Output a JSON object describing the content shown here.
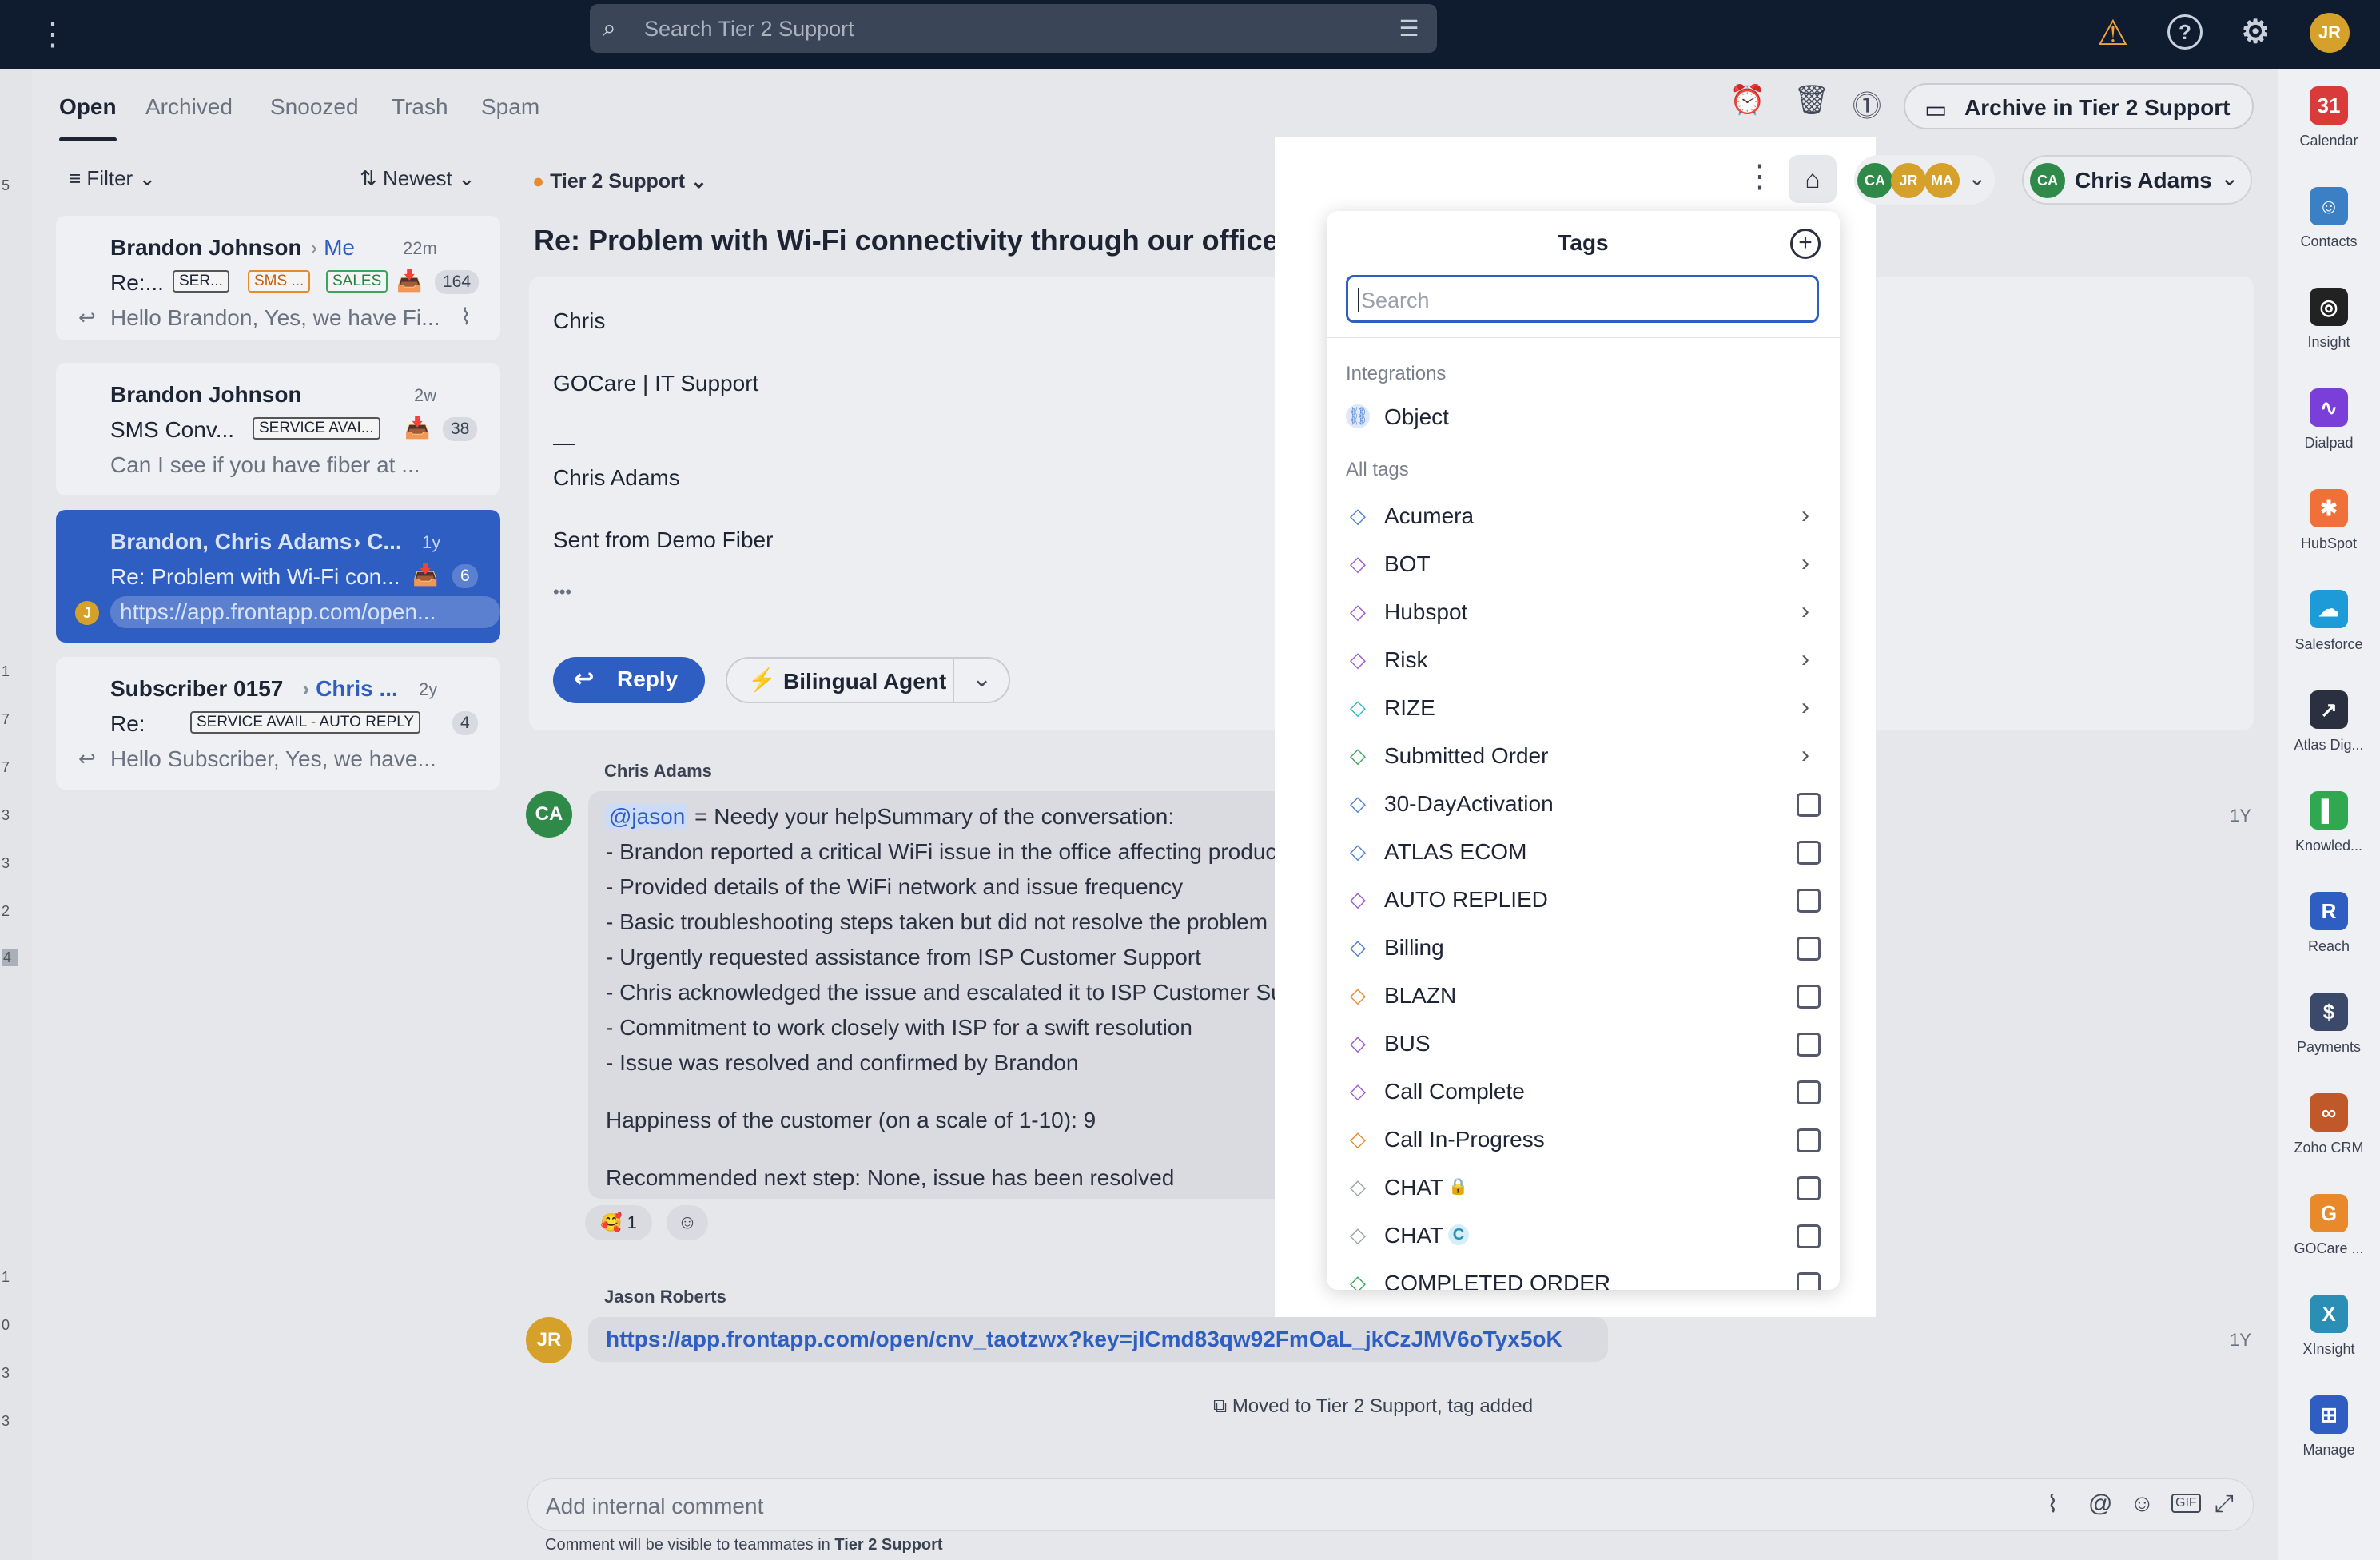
{
  "topbar": {
    "search_placeholder": "Search Tier 2 Support",
    "user_initials": "JR"
  },
  "tabs": [
    {
      "label": "Open",
      "active": true
    },
    {
      "label": "Archived"
    },
    {
      "label": "Snoozed"
    },
    {
      "label": "Trash"
    },
    {
      "label": "Spam"
    }
  ],
  "toolbar": {
    "archive_label": "Archive in Tier 2 Support"
  },
  "list": {
    "filter_label": "Filter",
    "sort_label": "Newest",
    "conversations": [
      {
        "name": "Brandon Johnson",
        "assignee": "Me",
        "time": "22m",
        "subject": "Re:...",
        "tags": [
          "SER...",
          "SMS ...",
          "SALES"
        ],
        "count": "164",
        "preview": "Hello Brandon, Yes, we have Fi..."
      },
      {
        "name": "Brandon Johnson",
        "time": "2w",
        "subject": "SMS Conv...",
        "tags": [
          "SERVICE AVAI..."
        ],
        "count": "38",
        "preview": "Can I see if you have fiber at ..."
      },
      {
        "name": "Brandon, Chris Adams",
        "assignee": "C...",
        "time": "1y",
        "subject": "Re: Problem with Wi-Fi con...",
        "count": "6",
        "preview": "https://app.frontapp.com/open...",
        "avatar": "J"
      },
      {
        "name": "Subscriber 0157",
        "assignee": "Chris ...",
        "time": "2y",
        "subject": "Re:",
        "tags": [
          "SERVICE AVAIL - AUTO REPLY"
        ],
        "count": "4",
        "preview": "Hello Subscriber, Yes, we have..."
      }
    ]
  },
  "left_strip_numbers": [
    "5",
    "1",
    "7",
    "7",
    "3",
    "3",
    "2",
    "4",
    "1",
    "0",
    "3",
    "3"
  ],
  "thread": {
    "inbox": "Tier 2 Support",
    "subject": "Re: Problem with Wi-Fi connectivity through our office",
    "message_lines": [
      "Chris",
      "GOCare | IT Support",
      "—",
      "Chris Adams",
      "Sent from Demo Fiber",
      "•••"
    ],
    "reply_label": "Reply",
    "agent_label": "Bilingual Agent",
    "comment": {
      "author": "Chris Adams",
      "avatar": "CA",
      "time": "1Y",
      "mention": "@jason",
      "first_line": " = Needy your helpSummary of the conversation:",
      "lines": [
        "- Brandon reported a critical WiFi issue in the office affecting productivity",
        "- Provided details of the WiFi network and issue frequency",
        "- Basic troubleshooting steps taken but did not resolve the problem",
        "- Urgently requested assistance from ISP Customer Support",
        "- Chris acknowledged the issue and escalated it to ISP Customer Support",
        "- Commitment to work closely with ISP for a swift resolution",
        "- Issue was resolved and confirmed by Brandon"
      ],
      "happiness": "Happiness of the customer (on a scale of 1-10): 9",
      "next_step": "Recommended next step: None, issue has been resolved",
      "reaction_count": "1"
    },
    "link_message": {
      "author": "Jason Roberts",
      "avatar": "JR",
      "time": "1Y",
      "url": "https://app.frontapp.com/open/cnv_taotzwx?key=jlCmd83qw92FmOaL_jkCzJMV6oTyx5oK"
    },
    "status_event": "Moved to Tier 2 Support, tag added",
    "composer_placeholder": "Add internal comment",
    "composer_hint_prefix": "Comment will be visible to teammates in ",
    "composer_hint_inbox": "Tier 2 Support"
  },
  "header_people": {
    "faces": [
      "CA",
      "JR",
      "MA"
    ],
    "assignee_initials": "CA",
    "assignee_name": "Chris Adams"
  },
  "tags_dropdown": {
    "title": "Tags",
    "search_placeholder": "Search",
    "integrations_label": "Integrations",
    "integration_item": "Object",
    "all_tags_label": "All tags",
    "tags": [
      {
        "name": "Acumera",
        "color": "#4a7fd4",
        "submenu": true
      },
      {
        "name": "BOT",
        "color": "#9b59d0",
        "submenu": true
      },
      {
        "name": "Hubspot",
        "color": "#9b59d0",
        "submenu": true
      },
      {
        "name": "Risk",
        "color": "#9b59d0",
        "submenu": true
      },
      {
        "name": "RIZE",
        "color": "#2bb5c7",
        "submenu": true
      },
      {
        "name": "Submitted Order",
        "color": "#3aa55b",
        "submenu": true
      },
      {
        "name": "30-DayActivation",
        "color": "#4a7fd4"
      },
      {
        "name": "ATLAS ECOM",
        "color": "#4a7fd4"
      },
      {
        "name": "AUTO REPLIED",
        "color": "#9b59d0"
      },
      {
        "name": "Billing",
        "color": "#4a7fd4"
      },
      {
        "name": "BLAZN",
        "color": "#e8892b"
      },
      {
        "name": "BUS",
        "color": "#9b59d0"
      },
      {
        "name": "Call Complete",
        "color": "#9b59d0"
      },
      {
        "name": "Call In-Progress",
        "color": "#e8892b"
      },
      {
        "name": "CHAT",
        "color": "#9aa1ad",
        "badge": "🔒"
      },
      {
        "name": "CHAT",
        "color": "#9aa1ad",
        "badge": "C"
      },
      {
        "name": "COMPLETED ORDER",
        "color": "#3aa55b"
      }
    ]
  },
  "apps": [
    {
      "name": "Calendar",
      "glyph": "31",
      "color": "#d93b3b"
    },
    {
      "name": "Contacts",
      "glyph": "☺",
      "color": "#3b7fc4"
    },
    {
      "name": "Insight",
      "glyph": "◎",
      "color": "#222222"
    },
    {
      "name": "Dialpad",
      "glyph": "∿",
      "color": "#7b3fd9"
    },
    {
      "name": "HubSpot",
      "glyph": "✱",
      "color": "#f0703a"
    },
    {
      "name": "Salesforce",
      "glyph": "☁",
      "color": "#1c9bd8"
    },
    {
      "name": "Atlas Dig...",
      "glyph": "↗",
      "color": "#2a3040"
    },
    {
      "name": "Knowled...",
      "glyph": "▌",
      "color": "#2fa84f"
    },
    {
      "name": "Reach",
      "glyph": "R",
      "color": "#2f5ec2"
    },
    {
      "name": "Payments",
      "glyph": "$",
      "color": "#3b4a6b"
    },
    {
      "name": "Zoho CRM",
      "glyph": "∞",
      "color": "#c0582a"
    },
    {
      "name": "GOCare ...",
      "glyph": "G",
      "color": "#e8892b"
    },
    {
      "name": "XInsight",
      "glyph": "X",
      "color": "#2b8fb5"
    },
    {
      "name": "Manage",
      "glyph": "⊞",
      "color": "#2f5ec2"
    }
  ]
}
